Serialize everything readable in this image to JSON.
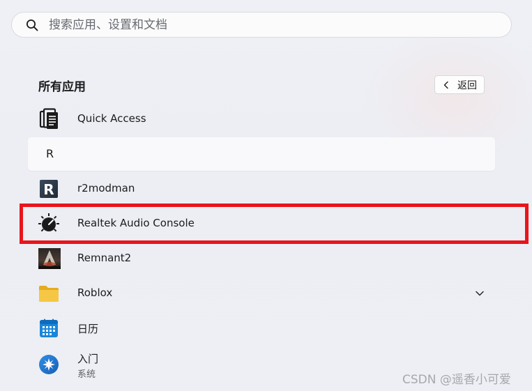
{
  "search": {
    "placeholder": "搜索应用、设置和文档",
    "value": ""
  },
  "section": {
    "title": "所有应用",
    "back_label": "返回"
  },
  "apps_before": [
    {
      "name": "Quick Access",
      "icon": "quick-access-icon"
    }
  ],
  "letter_header": "R",
  "apps": [
    {
      "name": "r2modman",
      "icon": "r2modman-icon"
    },
    {
      "name": "Realtek Audio Console",
      "icon": "realtek-knob-icon",
      "highlighted": true
    },
    {
      "name": "Remnant2",
      "icon": "remnant2-game-icon"
    },
    {
      "name": "Roblox",
      "icon": "folder-icon",
      "expandable": true
    },
    {
      "name": "日历",
      "icon": "calendar-icon"
    },
    {
      "name": "入门",
      "subtitle": "系统",
      "icon": "getstarted-icon"
    }
  ],
  "colors": {
    "highlight": "#e8151b",
    "calendar_blue": "#1a86d9",
    "folder_yellow": "#f6c744"
  },
  "watermark": "CSDN @遥香小可爱"
}
